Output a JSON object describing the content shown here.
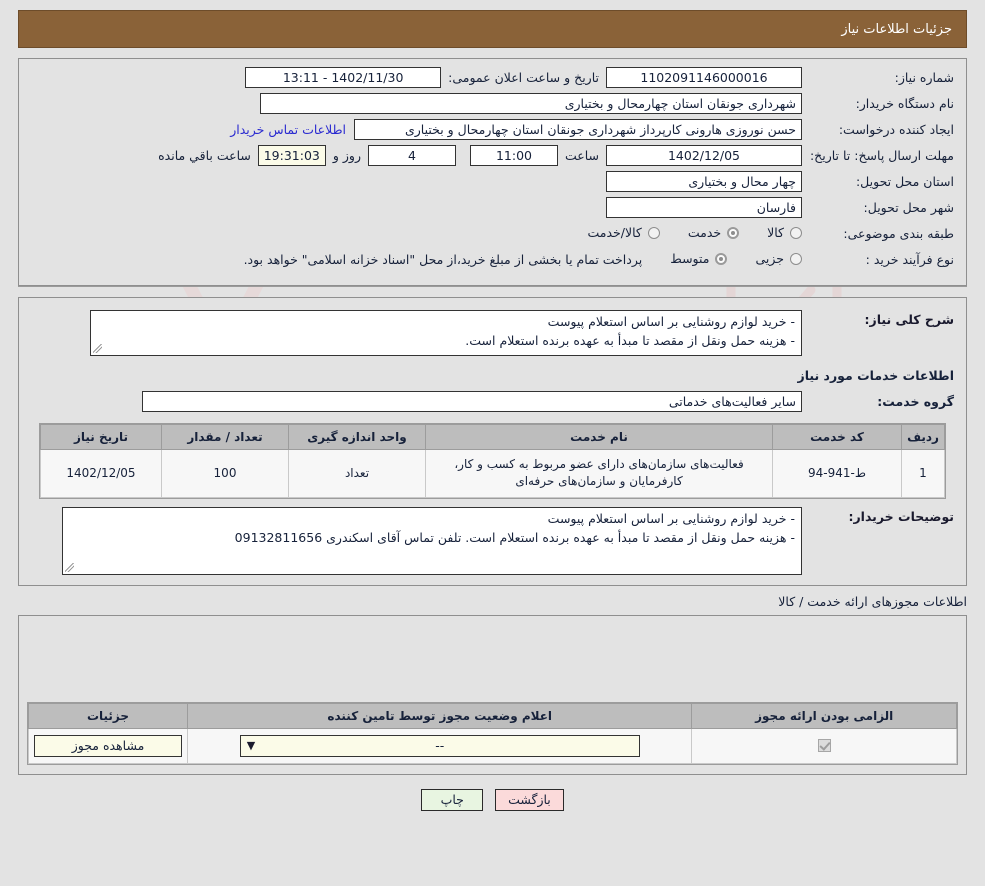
{
  "header": {
    "title": "جزئیات اطلاعات نیاز",
    "bg_color": "#8a6238"
  },
  "need_form": {
    "labels": {
      "need_number": "شماره نیاز:",
      "buyer_org": "نام دستگاه خریدار:",
      "requester": "ایجاد کننده درخواست:",
      "deadline": "مهلت ارسال پاسخ: تا تاریخ:",
      "delivery_province": "استان محل تحویل:",
      "delivery_city": "شهر محل تحویل:",
      "subject_category": "طبقه بندی موضوعی:",
      "purchase_process": "نوع فرآیند خرید :",
      "announce_datetime": "تاریخ و ساعت اعلان عمومی:",
      "hour": "ساعت",
      "day_and": "روز و",
      "hours_remaining": "ساعت باقي مانده",
      "contact_link": "اطلاعات تماس خریدار"
    },
    "values": {
      "need_number": "1102091146000016",
      "buyer_org": "شهرداری جونقان استان چهارمحال و بختیاری",
      "requester": "حسن نوروزی هارونی کارپرداز شهرداری جونقان استان چهارمحال و بختیاری",
      "deadline_date": "1402/12/05",
      "deadline_time": "11:00",
      "days_remaining": "4",
      "countdown": "19:31:03",
      "announce_datetime": "1402/11/30 - 13:11",
      "delivery_province": "چهار محال و بختیاری",
      "delivery_city": "فارسان"
    },
    "subject_category_options": [
      {
        "label": "کالا",
        "selected": false
      },
      {
        "label": "خدمت",
        "selected": true
      },
      {
        "label": "کالا/خدمت",
        "selected": false
      }
    ],
    "purchase_process_options": [
      {
        "label": "جزیی",
        "selected": false
      },
      {
        "label": "متوسط",
        "selected": true
      }
    ],
    "payment_note": "پرداخت تمام یا بخشی از مبلغ خرید،از محل \"اسناد خزانه اسلامی\" خواهد بود."
  },
  "summary": {
    "label": "شرح کلی نیاز:",
    "text": "- خرید لوازم روشنایی بر اساس استعلام پیوست\n- هزینه حمل ونقل از مقصد تا مبدأ به عهده برنده استعلام است."
  },
  "services_section": {
    "title": "اطلاعات خدمات مورد نیاز",
    "service_group_label": "گروه خدمت:",
    "service_group_value": "سایر فعالیت‌های خدماتی",
    "table": {
      "columns": [
        "ردیف",
        "کد خدمت",
        "نام خدمت",
        "واحد اندازه گیری",
        "تعداد / مقدار",
        "تاریخ نیاز"
      ],
      "rows": [
        {
          "row": "1",
          "code": "ط-941-94",
          "name": "فعالیت‌های سازمان‌های دارای عضو مربوط به کسب و کار، کارفرمایان و سازمان‌های حرفه‌ای",
          "unit": "تعداد",
          "quantity": "100",
          "need_date": "1402/12/05"
        }
      ]
    }
  },
  "buyer_notes": {
    "label": "توضیحات خریدار:",
    "text": "- خرید لوازم روشنایی بر اساس استعلام پیوست\n- هزینه حمل ونقل از مقصد تا مبدأ به عهده برنده استعلام است. تلفن تماس آقای اسکندری 09132811656"
  },
  "permits_section": {
    "title": "اطلاعات مجوزهای ارائه خدمت / کالا",
    "table": {
      "columns": [
        "الزامی بودن ارائه مجوز",
        "اعلام وضعیت مجوز توسط تامین کننده",
        "جزئیات"
      ],
      "rows": [
        {
          "required_checked": true,
          "status_value": "--",
          "detail_button": "مشاهده مجوز"
        }
      ]
    }
  },
  "footer": {
    "back_button": "بازگشت",
    "print_button": "چاپ"
  },
  "watermark": {
    "text": "AriaTender.net"
  }
}
